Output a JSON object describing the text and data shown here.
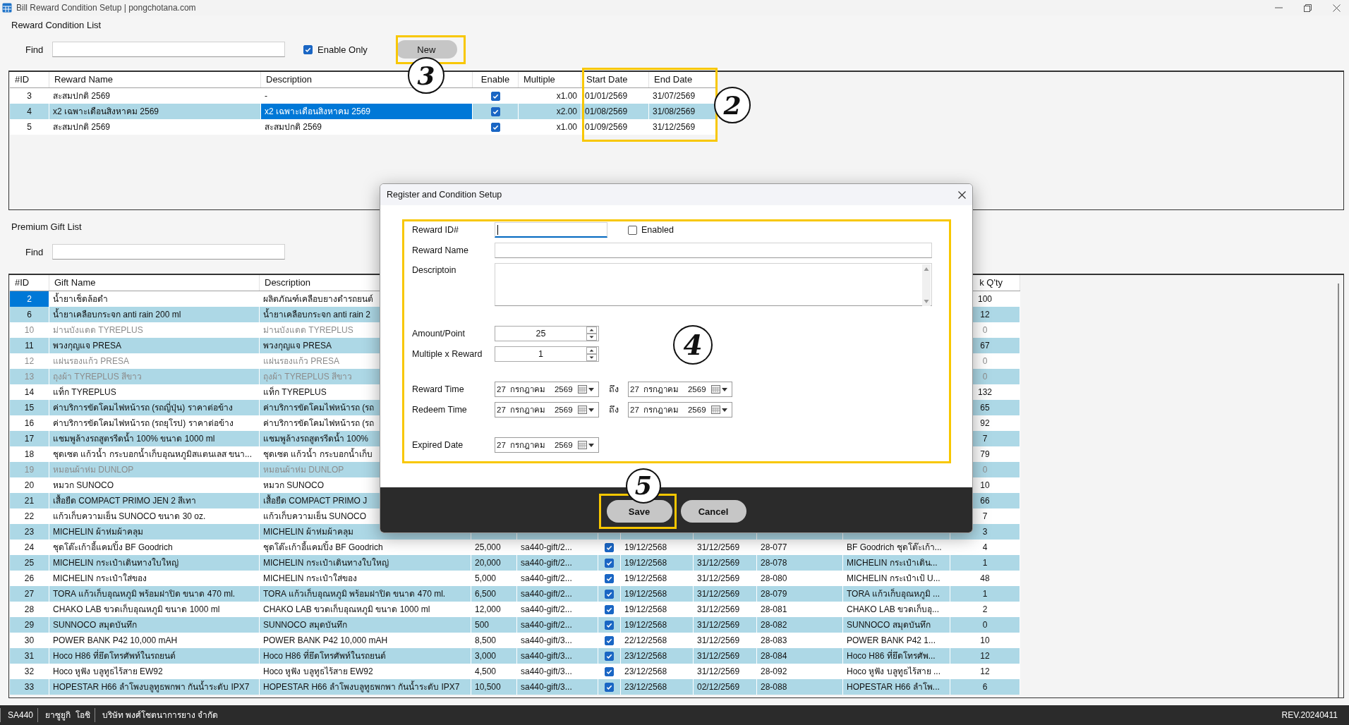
{
  "window": {
    "title": "Bill Reward Condition Setup | pongchotana.com"
  },
  "reward_condition_list": {
    "title": "Reward Condition List",
    "find_label": "Find",
    "enable_only": {
      "label": "Enable Only",
      "checked": true
    },
    "new_button": "New",
    "table": {
      "columns": [
        {
          "label": "#ID",
          "current": false
        },
        {
          "label": "Reward Name",
          "current": false
        },
        {
          "label": "Description",
          "current": true
        },
        {
          "label": "Enable",
          "current": false
        },
        {
          "label": "Multiple",
          "current": false
        },
        {
          "label": "Start Date",
          "current": false
        },
        {
          "label": "End Date",
          "current": false
        }
      ],
      "rows": [
        {
          "id": "3",
          "name": "สะสมปกติ 2569",
          "description": "-",
          "enable": true,
          "multiple": "x1.00",
          "start_date": "01/01/2569",
          "end_date": "31/07/2569",
          "selected": false
        },
        {
          "id": "4",
          "name": "x2 เฉพาะเดือนสิงหาคม 2569",
          "description": "x2 เฉพาะเดือนสิงหาคม 2569",
          "enable": true,
          "multiple": "x2.00",
          "start_date": "01/08/2569",
          "end_date": "31/08/2569",
          "selected": true
        },
        {
          "id": "5",
          "name": "สะสมปกติ 2569",
          "description": "สะสมปกติ 2569",
          "enable": true,
          "multiple": "x1.00",
          "start_date": "01/09/2569",
          "end_date": "31/12/2569",
          "selected": false
        }
      ]
    }
  },
  "premium_gift_list": {
    "title": "Premium Gift List",
    "find_label": "Find",
    "table": {
      "columns": [
        {
          "label": "#ID",
          "current": true
        },
        {
          "label": "Gift Name",
          "current": false
        },
        {
          "label": "Description",
          "current": false
        },
        {
          "label": "k Q'ty",
          "current": false
        }
      ],
      "rows": [
        {
          "id": "2",
          "name": "น้ำยาเช็ดล้อดำ",
          "description": "ผลิตภัณฑ์เคลือบยางดำรถยนต์",
          "qty": "100",
          "selected": true,
          "disabled": false
        },
        {
          "id": "6",
          "name": "น้ำยาเคลือบกระจก anti rain 200 ml",
          "description": "น้ำยาเคลือบกระจก anti rain 2",
          "qty": "12",
          "selected": false,
          "disabled": false
        },
        {
          "id": "10",
          "name": "ม่านบังแดด TYREPLUS",
          "description": "ม่านบังแดด TYREPLUS",
          "qty": "0",
          "selected": false,
          "disabled": true
        },
        {
          "id": "11",
          "name": "พวงกุญแจ PRESA",
          "description": "พวงกุญแจ PRESA",
          "qty": "67",
          "selected": false,
          "disabled": false
        },
        {
          "id": "12",
          "name": "แผ่นรองแก้ว PRESA",
          "description": "แผ่นรองแก้ว PRESA",
          "qty": "0",
          "selected": false,
          "disabled": true
        },
        {
          "id": "13",
          "name": "ถุงผ้า TYREPLUS สีขาว",
          "description": "ถุงผ้า TYREPLUS สีขาว",
          "qty": "0",
          "selected": false,
          "disabled": true
        },
        {
          "id": "14",
          "name": "แท็ก TYREPLUS",
          "description": "แท็ก TYREPLUS",
          "qty": "132",
          "selected": false,
          "disabled": false
        },
        {
          "id": "15",
          "name": "ค่าบริการขัดโคมไฟหน้ารถ (รถญี่ปุ่น) ราคาต่อข้าง",
          "description": "ค่าบริการขัดโคมไฟหน้ารถ (รถ",
          "qty": "65",
          "selected": false,
          "disabled": false
        },
        {
          "id": "16",
          "name": "ค่าบริการขัดโคมไฟหน้ารถ (รถยุโรป) ราคาต่อข้าง",
          "description": "ค่าบริการขัดโคมไฟหน้ารถ (รถ",
          "qty": "92",
          "selected": false,
          "disabled": false
        },
        {
          "id": "17",
          "name": "แชมพูล้างรถสูตรรีดน้ำ 100% ขนาด 1000  ml",
          "description": "แชมพูล้างรถสูตรรีดน้ำ 100%",
          "qty": "7",
          "selected": false,
          "disabled": false
        },
        {
          "id": "18",
          "name": "ชุดเซต แก้วน้ำ กระบอกน้ำเก็บอุณหภูมิสแตนเลส ขนา...",
          "description": "ชุดเซต แก้วน้ำ กระบอกน้ำเก็บ",
          "qty": "79",
          "selected": false,
          "disabled": false
        },
        {
          "id": "19",
          "name": "หมอนผ้าห่ม DUNLOP",
          "description": "หมอนผ้าห่ม DUNLOP",
          "qty": "0",
          "selected": false,
          "disabled": true
        },
        {
          "id": "20",
          "name": "หมวก SUNOCO",
          "description": "หมวก SUNOCO",
          "qty": "10",
          "selected": false,
          "disabled": false
        },
        {
          "id": "21",
          "name": "เสื้อยืด COMPACT PRIMO JEN 2  สีเทา",
          "description": "เสื้อยืด COMPACT PRIMO J",
          "qty": "66",
          "selected": false,
          "disabled": false
        },
        {
          "id": "22",
          "name": "แก้วเก็บความเย็น SUNOCO ขนาด 30 oz.",
          "description": "แก้วเก็บความเย็น SUNOCO",
          "qty": "7",
          "selected": false,
          "disabled": false
        },
        {
          "id": "23",
          "name": "MICHELIN ผ้าห่มผ้าคลุม",
          "description": "MICHELIN ผ้าห่มผ้าคลุม",
          "qty": "3",
          "selected": false,
          "disabled": false
        },
        {
          "id": "24",
          "name": "ชุดโต๊ะเก้าอี้แคมปิ้ง BF Goodrich",
          "description": "ชุดโต๊ะเก้าอี้แคมปิ้ง BF Goodrich",
          "amount": "25,000",
          "image": "sa440-gift/2...",
          "enabled": true,
          "start_date": "19/12/2568",
          "end_date": "31/12/2569",
          "code": "28-077",
          "short_name": "BF Goodrich ชุดโต๊ะเก้า...",
          "qty": "4",
          "selected": false,
          "disabled": false
        },
        {
          "id": "25",
          "name": "MICHELIN กระเป๋าเดินทางใบใหญ่",
          "description": "MICHELIN กระเป๋าเดินทางใบใหญ่",
          "amount": "20,000",
          "image": "sa440-gift/2...",
          "enabled": true,
          "start_date": "19/12/2568",
          "end_date": "31/12/2569",
          "code": "28-078",
          "short_name": "MICHELIN กระเป๋าเดิน...",
          "qty": "1",
          "selected": false,
          "disabled": false
        },
        {
          "id": "26",
          "name": "MICHELIN กระเป๋าใส่ของ",
          "description": "MICHELIN กระเป๋าใส่ของ",
          "amount": "5,000",
          "image": "sa440-gift/2...",
          "enabled": true,
          "start_date": "19/12/2568",
          "end_date": "31/12/2569",
          "code": "28-080",
          "short_name": "MICHELIN กระเป๋าเป้ U...",
          "qty": "48",
          "selected": false,
          "disabled": false
        },
        {
          "id": "27",
          "name": "TORA แก้วเก็บอุณหภูมิ พร้อมฝาปิด ขนาด  470 ml.",
          "description": "TORA แก้วเก็บอุณหภูมิ พร้อมฝาปิด ขนาด  470 ml.",
          "amount": "6,500",
          "image": "sa440-gift/2...",
          "enabled": true,
          "start_date": "19/12/2568",
          "end_date": "31/12/2569",
          "code": "28-079",
          "short_name": "TORA แก้วเก็บอุณหภูมิ ...",
          "qty": "1",
          "selected": false,
          "disabled": false
        },
        {
          "id": "28",
          "name": "CHAKO LAB ขวดเก็บอุณหภูมิ ขนาด 1000 ml",
          "description": "CHAKO LAB ขวดเก็บอุณหภูมิ ขนาด 1000 ml",
          "amount": "12,000",
          "image": "sa440-gift/2...",
          "enabled": true,
          "start_date": "19/12/2568",
          "end_date": "31/12/2569",
          "code": "28-081",
          "short_name": "CHAKO LAB ขวดเก็บอุ...",
          "qty": "2",
          "selected": false,
          "disabled": false
        },
        {
          "id": "29",
          "name": "SUNNOCO สมุดบันทึก",
          "description": "SUNNOCO สมุดบันทึก",
          "amount": "500",
          "image": "sa440-gift/2...",
          "enabled": true,
          "start_date": "19/12/2568",
          "end_date": "31/12/2569",
          "code": "28-082",
          "short_name": "SUNNOCO สมุดบันทึก",
          "qty": "0",
          "selected": false,
          "disabled": false
        },
        {
          "id": "30",
          "name": "POWER BANK P42 10,000 mAH",
          "description": "POWER BANK P42 10,000 mAH",
          "amount": "8,500",
          "image": "sa440-gift/3...",
          "enabled": true,
          "start_date": "22/12/2568",
          "end_date": "31/12/2569",
          "code": "28-083",
          "short_name": "POWER BANK P42 1...",
          "qty": "10",
          "selected": false,
          "disabled": false
        },
        {
          "id": "31",
          "name": "Hoco H86 ที่ยึดโทรศัพท์ในรถยนต์",
          "description": "Hoco H86 ที่ยึดโทรศัพท์ในรถยนต์",
          "amount": "3,000",
          "image": "sa440-gift/3...",
          "enabled": true,
          "start_date": "23/12/2568",
          "end_date": "31/12/2569",
          "code": "28-084",
          "short_name": "Hoco H86 ที่ยึดโทรศัพ...",
          "qty": "12",
          "selected": false,
          "disabled": false
        },
        {
          "id": "32",
          "name": "Hoco หูฟัง บลูทูธไร้สาย EW92",
          "description": "Hoco หูฟัง บลูทูธไร้สาย EW92",
          "amount": "4,500",
          "image": "sa440-gift/3...",
          "enabled": true,
          "start_date": "23/12/2568",
          "end_date": "31/12/2569",
          "code": "28-092",
          "short_name": "Hoco หูฟัง บลูทูธไร้สาย ...",
          "qty": "12",
          "selected": false,
          "disabled": false
        },
        {
          "id": "33",
          "name": "HOPESTAR H66 ลำโพงบลูทูธพกพา กันน้ำระดับ IPX7",
          "description": "HOPESTAR H66 ลำโพงบลูทูธพกพา กันน้ำระดับ IPX7",
          "amount": "10,500",
          "image": "sa440-gift/3...",
          "enabled": true,
          "start_date": "23/12/2568",
          "end_date": "02/12/2569",
          "code": "28-088",
          "short_name": "HOPESTAR H66 ลำโพ...",
          "qty": "6",
          "selected": false,
          "disabled": false
        }
      ]
    }
  },
  "dialog": {
    "title": "Register and Condition Setup",
    "fields": [
      {
        "kind": "text_id",
        "label": "Reward ID#",
        "focused": true,
        "enabled": {
          "label": "Enabled",
          "checked": false
        }
      },
      {
        "kind": "text",
        "label": "Reward Name",
        "focused": false
      },
      {
        "kind": "textarea",
        "label": "Descriptoin"
      },
      {
        "kind": "spin",
        "label": "Amount/Point",
        "value": "25"
      },
      {
        "kind": "spin",
        "label": "Multiple x Reward",
        "value": "1"
      },
      {
        "kind": "range",
        "label": "Reward Time",
        "from": "27  กรกฎาคม    2569",
        "separator": "ถึง",
        "to": "27  กรกฎาคม    2569"
      },
      {
        "kind": "range",
        "label": "Redeem Time",
        "from": "27  กรกฎาคม    2569",
        "separator": "ถึง",
        "to": "27  กรกฎาคม    2569"
      },
      {
        "kind": "date",
        "label": "Expired Date",
        "value": "27  กรกฎาคม    2569"
      }
    ],
    "buttons": [
      "Save",
      "Cancel"
    ]
  },
  "status_bar": {
    "items": [
      "SA440",
      "ยาซูยูกิ  โอชิ",
      "บริษัท พงศ์โชตนาการยาง จำกัด"
    ],
    "revision": "REV.20240411"
  },
  "annotations": [
    {
      "number": "3"
    },
    {
      "number": "2"
    },
    {
      "number": "4"
    },
    {
      "number": "5"
    }
  ]
}
